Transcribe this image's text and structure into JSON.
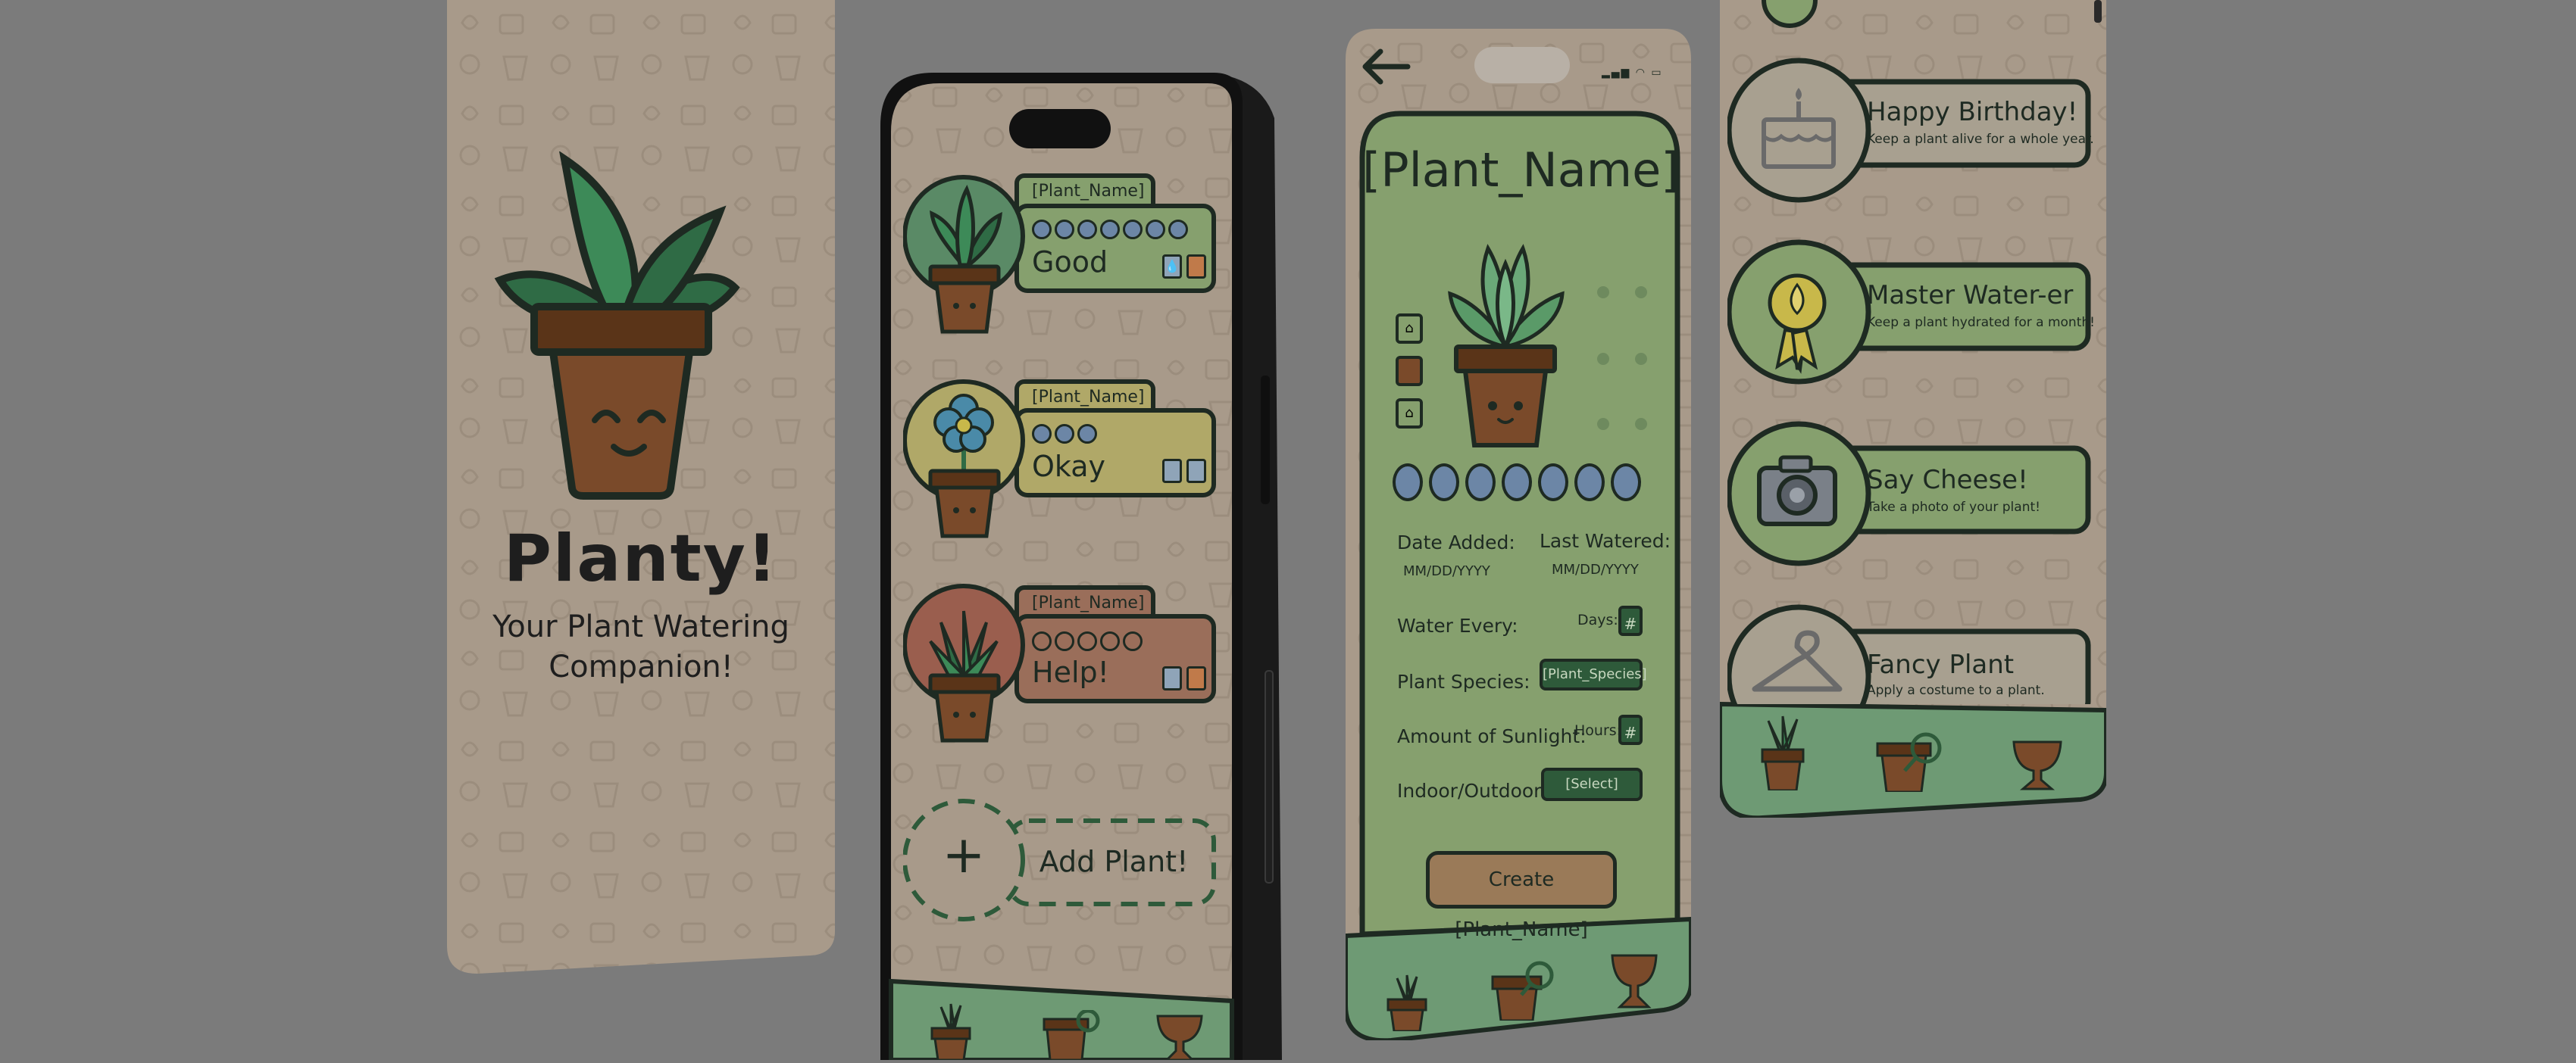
{
  "colors": {
    "background": "#7b7b7b",
    "screen_tan": "#a89a8a",
    "pattern": "#9a8c7c",
    "green_light": "#86a06e",
    "green_dark": "#2e5a3a",
    "outline": "#1e2a22",
    "pot": "#7a4a2a",
    "pot_dark": "#5a3418",
    "leaf": "#2f6b45",
    "leaf_light": "#3d8a58",
    "yellow_card": "#b0a868",
    "red_card": "#9a6e5a",
    "nav_green": "#6e9a74",
    "bubble_blue": "#6c86a6"
  },
  "splash": {
    "title": "Planty!",
    "subtitle_line1": "Your Plant Watering",
    "subtitle_line2": "Companion!"
  },
  "plant_list": {
    "items": [
      {
        "name": "[Plant_Name]",
        "status": "Good",
        "bubble_count": 7,
        "card_color": "#86a06e",
        "circle_color": "#5a8a66",
        "icon_name": "succulent-icon"
      },
      {
        "name": "[Plant_Name]",
        "status": "Okay",
        "bubble_count": 3,
        "card_color": "#b0a868",
        "circle_color": "#b0a868",
        "icon_name": "blue-flower-icon"
      },
      {
        "name": "[Plant_Name]",
        "status": "Help!",
        "bubble_count": 5,
        "card_color": "#9a6e5a",
        "circle_color": "#9a5e4e",
        "icon_name": "grass-plant-icon"
      }
    ],
    "add_label": "Add Plant!",
    "add_symbol": "+"
  },
  "create_form": {
    "title": "[Plant_Name]",
    "date_added_label": "Date Added:",
    "date_added_value": "MM/DD/YYYY",
    "last_watered_label": "Last Watered:",
    "last_watered_value": "MM/DD/YYYY",
    "water_every_label": "Water Every:",
    "days_label": "Days:",
    "days_value": "#",
    "species_label": "Plant Species:",
    "species_value": "[Plant_Species]",
    "sunlight_label": "Amount of Sunlight:",
    "hours_label": "Hours:",
    "hours_value": "#",
    "indoor_label": "Indoor/Outdoor:",
    "indoor_value": "[Select]",
    "create_button": "Create [Plant_Name]",
    "water_bubbles": 7
  },
  "achievements": {
    "items": [
      {
        "title": "Happy Birthday!",
        "description": "Keep a plant alive for a whole year.",
        "icon_name": "cake-icon",
        "unlocked": false
      },
      {
        "title": "Master Water-er",
        "description": "Keep a plant hydrated for a month!",
        "icon_name": "water-medal-icon",
        "unlocked": true
      },
      {
        "title": "Say Cheese!",
        "description": "Take a photo of your plant!",
        "icon_name": "camera-icon",
        "unlocked": true
      },
      {
        "title": "Fancy Plant",
        "description": "Apply a costume to a plant.",
        "icon_name": "hanger-icon",
        "unlocked": false
      }
    ]
  },
  "nav": {
    "items": [
      {
        "name": "plants",
        "icon_name": "plant-pot-nav-icon"
      },
      {
        "name": "add",
        "icon_name": "pot-search-nav-icon"
      },
      {
        "name": "achievements",
        "icon_name": "trophy-nav-icon"
      }
    ]
  }
}
